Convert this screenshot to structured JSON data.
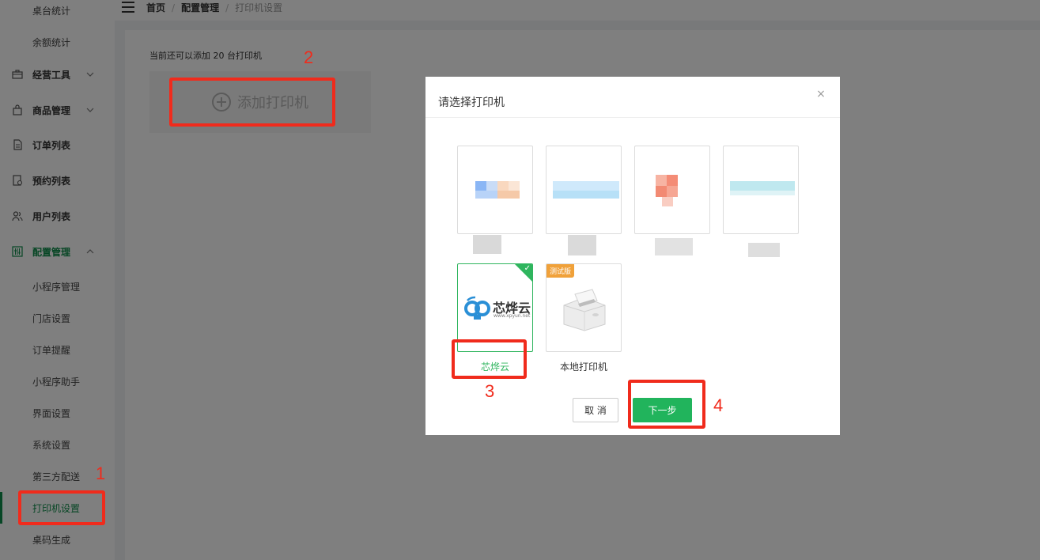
{
  "sidebar": {
    "items": [
      {
        "label": "桌台统计"
      },
      {
        "label": "余额统计"
      },
      {
        "label": "经营工具"
      },
      {
        "label": "商品管理"
      },
      {
        "label": "订单列表"
      },
      {
        "label": "预约列表"
      },
      {
        "label": "用户列表"
      },
      {
        "label": "配置管理"
      },
      {
        "label": "小程序管理"
      },
      {
        "label": "门店设置"
      },
      {
        "label": "订单提醒"
      },
      {
        "label": "小程序助手"
      },
      {
        "label": "界面设置"
      },
      {
        "label": "系统设置"
      },
      {
        "label": "第三方配送"
      },
      {
        "label": "打印机设置"
      },
      {
        "label": "桌码生成"
      }
    ]
  },
  "header": {
    "breadcrumb": [
      "首页",
      "配置管理",
      "打印机设置"
    ],
    "separator": "/"
  },
  "main": {
    "hint": "当前还可以添加 20 台打印机",
    "add_button_label": "添加打印机"
  },
  "dialog": {
    "title": "请选择打印机",
    "close_glyph": "×",
    "printers": [
      {
        "label": ""
      },
      {
        "label": ""
      },
      {
        "label": ""
      },
      {
        "label": ""
      },
      {
        "label": "芯烨云",
        "logo_text": "芯烨云",
        "logo_url": "www.xpyun.net",
        "selected": true
      },
      {
        "label": "本地打印机",
        "badge": "测试版"
      }
    ],
    "check_glyph": "✓",
    "cancel_label": "取 消",
    "next_label": "下一步"
  },
  "annotations": [
    "1",
    "2",
    "3",
    "4"
  ],
  "colors": {
    "accent_green": "#21b45c",
    "menu_active": "#0e8d4a",
    "annotation_red": "#f02b1c",
    "badge_orange": "#f0a13a"
  }
}
